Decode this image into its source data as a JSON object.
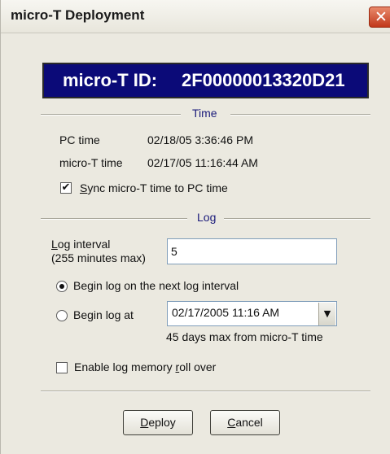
{
  "window": {
    "title": "micro-T Deployment",
    "close_glyph": "✕"
  },
  "banner": {
    "label": "micro-T ID:",
    "value": "2F00000013320D21"
  },
  "time_section": {
    "title": "Time",
    "pc_time_label": "PC time",
    "pc_time_value": "02/18/05 3:36:46 PM",
    "micro_time_label": "micro-T time",
    "micro_time_value": "02/17/05 11:16:44 AM",
    "sync_checked": true,
    "sync_label_accel": "S",
    "sync_label_rest": "ync micro-T time to PC time"
  },
  "log_section": {
    "title": "Log",
    "interval_label_accel": "L",
    "interval_label_rest": "og interval",
    "interval_hint": "(255 minutes max)",
    "interval_value": "5",
    "begin_next_label": "Begin log on the next log interval",
    "begin_next_selected": true,
    "begin_at_label": "Begin log at",
    "begin_at_selected": false,
    "begin_at_value": "02/17/2005 11:16 AM",
    "begin_at_hint": "45 days max from micro-T time",
    "rollover_checked": false,
    "rollover_label_pre": "Enable log memory ",
    "rollover_label_accel": "r",
    "rollover_label_post": "oll over"
  },
  "buttons": {
    "deploy_accel": "D",
    "deploy_rest": "eploy",
    "cancel_accel": "C",
    "cancel_rest": "ancel"
  },
  "icons": {
    "check": "✔",
    "dropdown": "▼"
  }
}
